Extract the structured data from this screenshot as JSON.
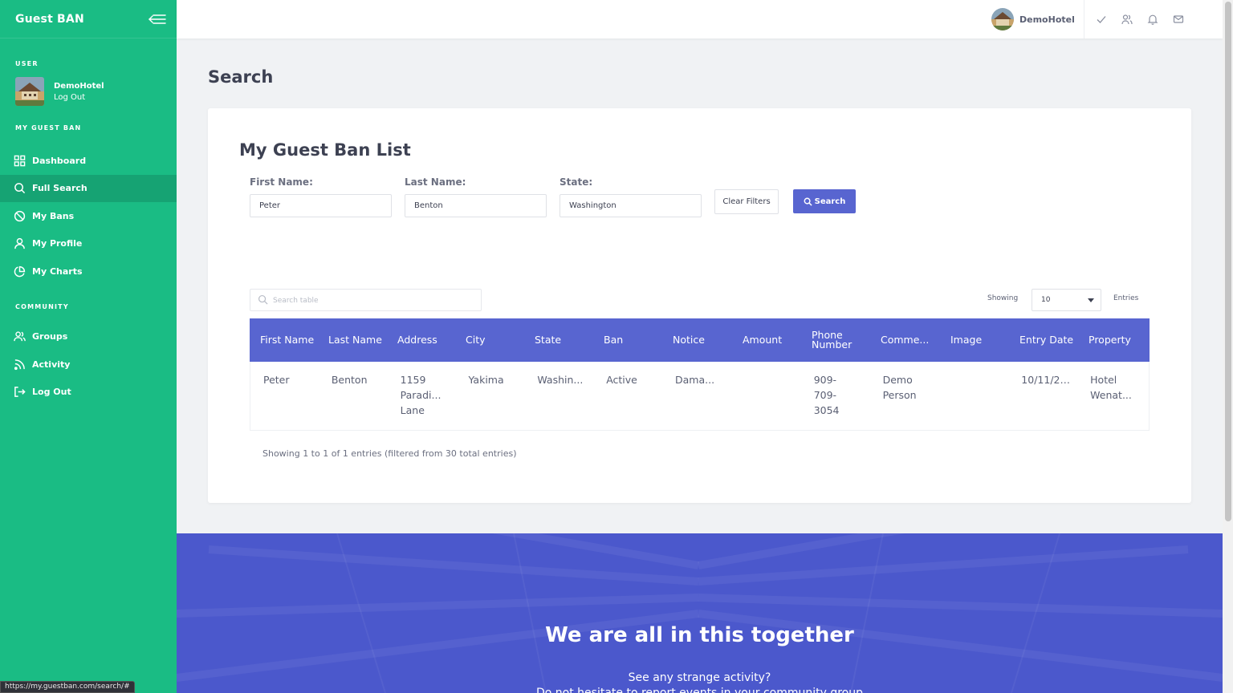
{
  "app": {
    "name": "Guest BAN"
  },
  "sidebar": {
    "user_section": "USER",
    "user_name": "DemoHotel",
    "user_logout": "Log Out",
    "section_main": "MY GUEST BAN",
    "items_main": [
      {
        "label": "Dashboard",
        "icon": "grid-icon"
      },
      {
        "label": "Full Search",
        "icon": "search-icon",
        "active": true
      },
      {
        "label": "My Bans",
        "icon": "ban-icon"
      },
      {
        "label": "My Profile",
        "icon": "user-icon"
      },
      {
        "label": "My Charts",
        "icon": "pie-chart-icon"
      }
    ],
    "section_community": "COMMUNITY",
    "items_community": [
      {
        "label": "Groups",
        "icon": "users-icon"
      },
      {
        "label": "Activity",
        "icon": "rss-icon"
      },
      {
        "label": "Log Out",
        "icon": "logout-icon"
      }
    ]
  },
  "topbar": {
    "user_name": "DemoHotel"
  },
  "page": {
    "title": "Search"
  },
  "card": {
    "title": "My Guest Ban List",
    "filters": {
      "first_name": {
        "label": "First Name:",
        "value": "Peter"
      },
      "last_name": {
        "label": "Last Name:",
        "value": "Benton"
      },
      "state": {
        "label": "State:",
        "value": "Washington"
      }
    },
    "clear_label": "Clear Filters",
    "search_label": "Search"
  },
  "table": {
    "search_placeholder": "Search table",
    "showing_label": "Showing",
    "page_size": "10",
    "entries_label": "Entries",
    "columns": [
      "First Name",
      "Last Name",
      "Address",
      "City",
      "State",
      "Ban",
      "Notice",
      "Amount",
      "Phone Number",
      "Comme...",
      "Image",
      "Entry Date",
      "Property"
    ],
    "rows": [
      [
        "Peter",
        "Benton",
        "1159 Paradi... Lane",
        "Yakima",
        "Washin...",
        "Active",
        "Dama...",
        "",
        "909-709-3054",
        "Demo Person",
        "",
        "10/11/201...",
        "Hotel Wenat..."
      ]
    ],
    "info": "Showing 1 to 1 of 1 entries (filtered from 30 total entries)"
  },
  "banner": {
    "title": "We are all in this together",
    "subtitle": "See any strange activity?",
    "subtitle2": "Do not hesitate to report events in your community group"
  },
  "status_url": "https://my.guestban.com/search/#",
  "colors": {
    "sidebar": "#1abc84",
    "primary": "#5865d0",
    "banner": "#4b58cc"
  }
}
